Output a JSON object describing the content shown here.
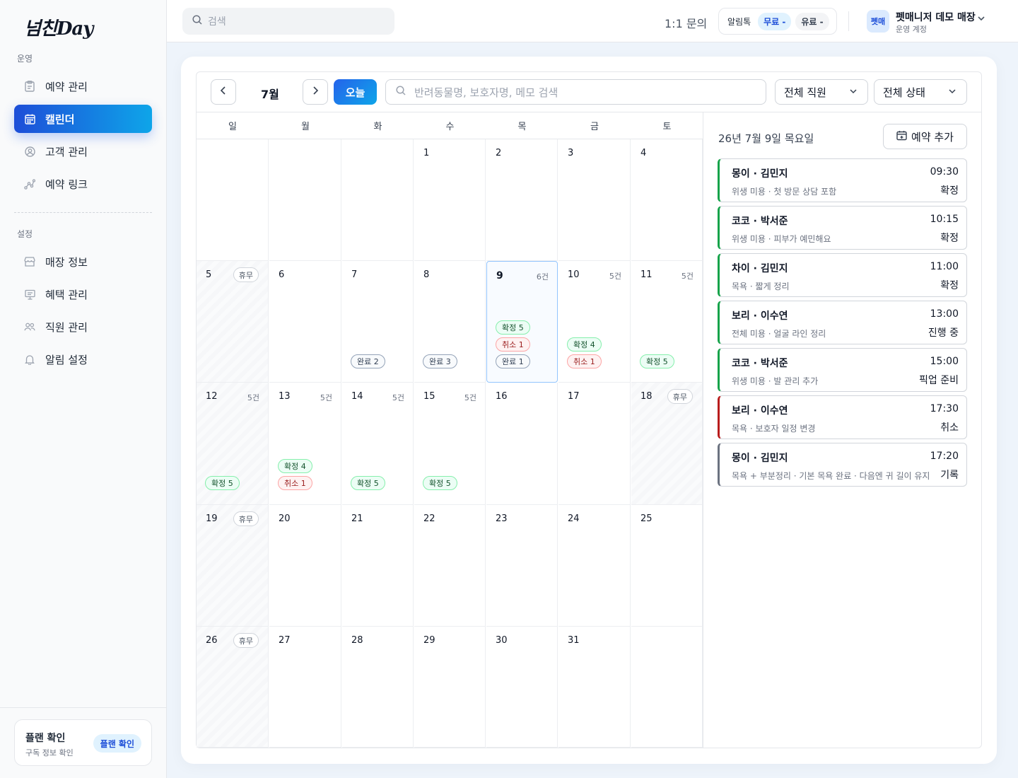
{
  "app": {
    "logo": "넘친Day"
  },
  "sidebar": {
    "section_ops": "운영",
    "section_settings": "설정",
    "ops_items": [
      {
        "label": "예약 관리",
        "icon": "clipboard-icon"
      },
      {
        "label": "캘린더",
        "icon": "calendar-icon",
        "active": true
      },
      {
        "label": "고객 관리",
        "icon": "user-circle-icon"
      },
      {
        "label": "예약 링크",
        "icon": "link-icon"
      }
    ],
    "settings_items": [
      {
        "label": "매장 정보",
        "icon": "store-icon"
      },
      {
        "label": "혜택 관리",
        "icon": "gift-icon"
      },
      {
        "label": "직원 관리",
        "icon": "users-icon"
      },
      {
        "label": "알림 설정",
        "icon": "bell-icon"
      }
    ],
    "plan": {
      "title": "플랜 확인",
      "subtitle": "구독 정보 확인",
      "button": "플랜 확인"
    }
  },
  "topbar": {
    "search_placeholder": "검색",
    "inquiry": "1:1 문의",
    "alimtalk_label": "알림톡",
    "free_label": "무료 -",
    "paid_label": "유료 -",
    "avatar_text": "펫매",
    "store_name": "펫매니저 데모 매장",
    "store_sub": "운영 계정"
  },
  "calendar": {
    "month_label": "7월",
    "today_label": "오늘",
    "search_placeholder": "반려동물명, 보호자명, 메모 검색",
    "staff_filter": "전체 직원",
    "status_filter": "전체 상태",
    "weekdays": [
      "일",
      "월",
      "화",
      "수",
      "목",
      "금",
      "토"
    ],
    "holiday_label": "휴무",
    "weeks": [
      [
        {
          "day": ""
        },
        {
          "day": ""
        },
        {
          "day": ""
        },
        {
          "day": "1"
        },
        {
          "day": "2"
        },
        {
          "day": "3"
        },
        {
          "day": "4"
        }
      ],
      [
        {
          "day": "5",
          "holiday": true
        },
        {
          "day": "6"
        },
        {
          "day": "7",
          "pills": [
            {
              "type": "done",
              "text": "완료 2"
            }
          ]
        },
        {
          "day": "8",
          "pills": [
            {
              "type": "done",
              "text": "완료 3"
            }
          ]
        },
        {
          "day": "9",
          "count": "6건",
          "selected": true,
          "pills": [
            {
              "type": "ok",
              "text": "확정 5"
            },
            {
              "type": "cancel",
              "text": "취소 1"
            },
            {
              "type": "done",
              "text": "완료 1"
            }
          ]
        },
        {
          "day": "10",
          "count": "5건",
          "pills": [
            {
              "type": "ok",
              "text": "확정 4"
            },
            {
              "type": "cancel",
              "text": "취소 1"
            }
          ]
        },
        {
          "day": "11",
          "count": "5건",
          "pills": [
            {
              "type": "ok",
              "text": "확정 5"
            }
          ]
        }
      ],
      [
        {
          "day": "12",
          "count": "5건",
          "hatched": true,
          "pills": [
            {
              "type": "ok",
              "text": "확정 5"
            }
          ]
        },
        {
          "day": "13",
          "count": "5건",
          "pills": [
            {
              "type": "ok",
              "text": "확정 4"
            },
            {
              "type": "cancel",
              "text": "취소 1"
            }
          ]
        },
        {
          "day": "14",
          "count": "5건",
          "pills": [
            {
              "type": "ok",
              "text": "확정 5"
            }
          ]
        },
        {
          "day": "15",
          "count": "5건",
          "pills": [
            {
              "type": "ok",
              "text": "확정 5"
            }
          ]
        },
        {
          "day": "16"
        },
        {
          "day": "17"
        },
        {
          "day": "18",
          "holiday": true
        }
      ],
      [
        {
          "day": "19",
          "holiday": true
        },
        {
          "day": "20"
        },
        {
          "day": "21"
        },
        {
          "day": "22"
        },
        {
          "day": "23"
        },
        {
          "day": "24"
        },
        {
          "day": "25"
        }
      ],
      [
        {
          "day": "26",
          "holiday": true
        },
        {
          "day": "27"
        },
        {
          "day": "28"
        },
        {
          "day": "29"
        },
        {
          "day": "30"
        },
        {
          "day": "31"
        },
        {
          "day": ""
        }
      ]
    ]
  },
  "panel": {
    "date_label": "26년 7월 9일 목요일",
    "add_label": "예약 추가",
    "appointments": [
      {
        "name": "몽이 · 김민지",
        "desc": "위생 미용 · 첫 방문 상담 포함",
        "time": "09:30",
        "status": "확정",
        "color": "green"
      },
      {
        "name": "코코 · 박서준",
        "desc": "위생 미용 · 피부가 예민해요",
        "time": "10:15",
        "status": "확정",
        "color": "green"
      },
      {
        "name": "차이 · 김민지",
        "desc": "목욕 · 짧게 정리",
        "time": "11:00",
        "status": "확정",
        "color": "green"
      },
      {
        "name": "보리 · 이수연",
        "desc": "전체 미용 · 얼굴 라인 정리",
        "time": "13:00",
        "status": "진행 중",
        "color": "green"
      },
      {
        "name": "코코 · 박서준",
        "desc": "위생 미용 · 발 관리 추가",
        "time": "15:00",
        "status": "픽업 준비",
        "color": "green"
      },
      {
        "name": "보리 · 이수연",
        "desc": "목욕 · 보호자 일정 변경",
        "time": "17:30",
        "status": "취소",
        "color": "red"
      },
      {
        "name": "몽이 · 김민지",
        "desc": "목욕 + 부분정리 · 기본 목욕 완료 · 다음엔 귀 길이 유지",
        "time": "17:20",
        "status": "기록",
        "color": "gray"
      }
    ]
  }
}
